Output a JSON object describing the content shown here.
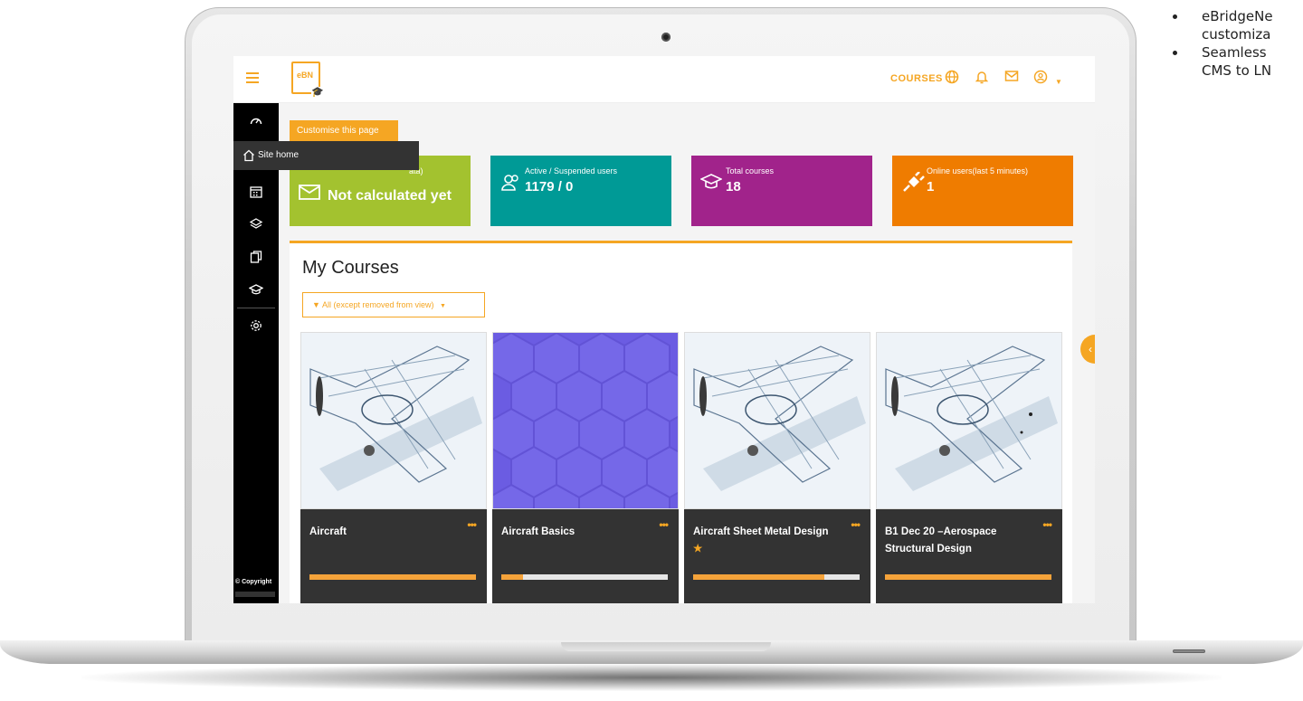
{
  "side_notes": [
    "eBridgeNe",
    "customiza",
    "Seamless",
    "CMS to LN"
  ],
  "navbar": {
    "logo_text": "eBN",
    "courses_label": "COURSES",
    "icons": [
      "globe-icon",
      "bell-icon",
      "mail-icon",
      "user-icon",
      "caret-down-icon"
    ]
  },
  "sidebar": {
    "tooltip_label": "Site home",
    "icons": [
      "dashboard-icon",
      "home-icon",
      "calendar-icon",
      "layers-icon",
      "copy-icon",
      "graduation-cap-icon",
      "settings-icon"
    ],
    "copyright": "© Copyright"
  },
  "main": {
    "customise_label": "Customise this page",
    "tiles": [
      {
        "label": "ata)",
        "value": "Not calculated yet",
        "icon": "mail-open-icon",
        "color": "#a3c22f"
      },
      {
        "label": "Active / Suspended users",
        "value": "1179 / 0",
        "icon": "users-icon",
        "color": "#009a96"
      },
      {
        "label": "Total courses",
        "value": "18",
        "icon": "graduation-cap-icon",
        "color": "#a1238b"
      },
      {
        "label": "Online users(last 5 minutes)",
        "value": "1",
        "icon": "plug-icon",
        "color": "#ef7c00"
      }
    ],
    "my_courses_title": "My Courses",
    "filter_label": "All (except removed from view)",
    "courses": [
      {
        "name": "Aircraft",
        "progress": 1.0,
        "starred": false
      },
      {
        "name": "Aircraft Basics",
        "progress": 0.13,
        "starred": false
      },
      {
        "name": "Aircraft Sheet Metal Design",
        "progress": 0.79,
        "starred": true
      },
      {
        "name": "B1 Dec 20 –Aerospace Structural Design",
        "progress": 1.0,
        "starred": false
      }
    ]
  },
  "colors": {
    "accent": "#f5a623",
    "sidebar": "#000000",
    "course_card": "#333333"
  }
}
